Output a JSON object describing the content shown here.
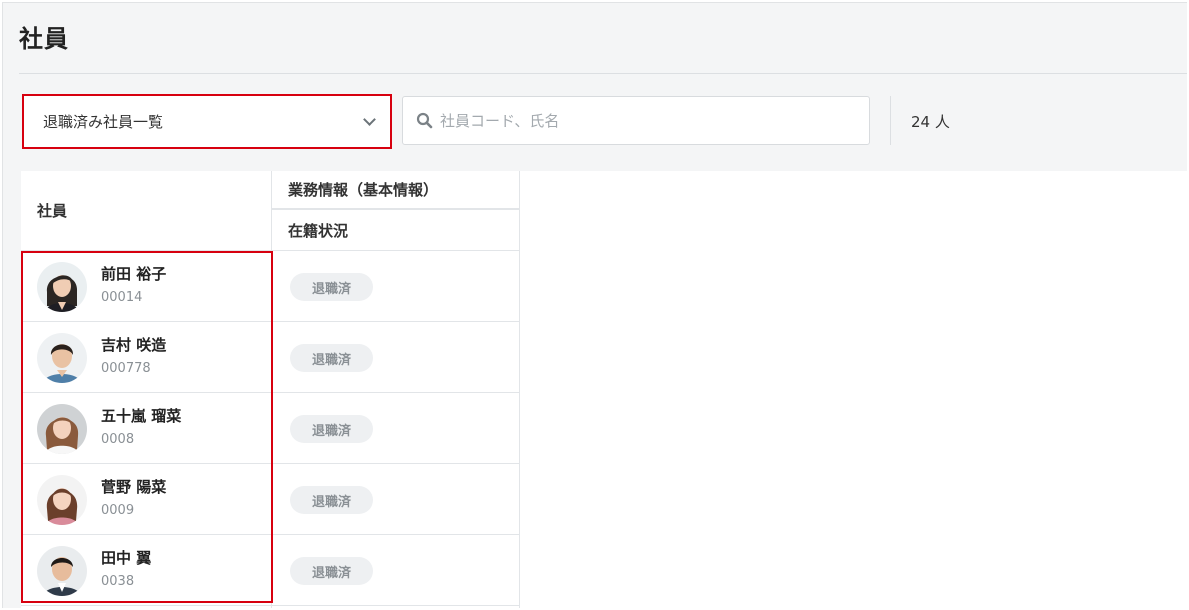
{
  "page": {
    "title": "社員"
  },
  "filter": {
    "selected": "退職済み社員一覧"
  },
  "search": {
    "placeholder": "社員コード、氏名",
    "value": ""
  },
  "count": {
    "label": "24 人"
  },
  "table": {
    "columns": {
      "employee": "社員",
      "group": "業務情報（基本情報）",
      "status": "在籍状況"
    },
    "rows": [
      {
        "name": "前田 裕子",
        "code": "00014",
        "status": "退職済",
        "avatar": "female-avatar"
      },
      {
        "name": "吉村 咲造",
        "code": "000778",
        "status": "退職済",
        "avatar": "male-avatar"
      },
      {
        "name": "五十嵐 瑠菜",
        "code": "0008",
        "status": "退職済",
        "avatar": "female-avatar"
      },
      {
        "name": "菅野 陽菜",
        "code": "0009",
        "status": "退職済",
        "avatar": "female-avatar"
      },
      {
        "name": "田中 翼",
        "code": "0038",
        "status": "退職済",
        "avatar": "male-avatar"
      }
    ]
  },
  "colors": {
    "highlight": "#d7000f",
    "background": "#f4f5f6",
    "badge_bg": "#eef0f2",
    "badge_text": "#8a9095"
  }
}
